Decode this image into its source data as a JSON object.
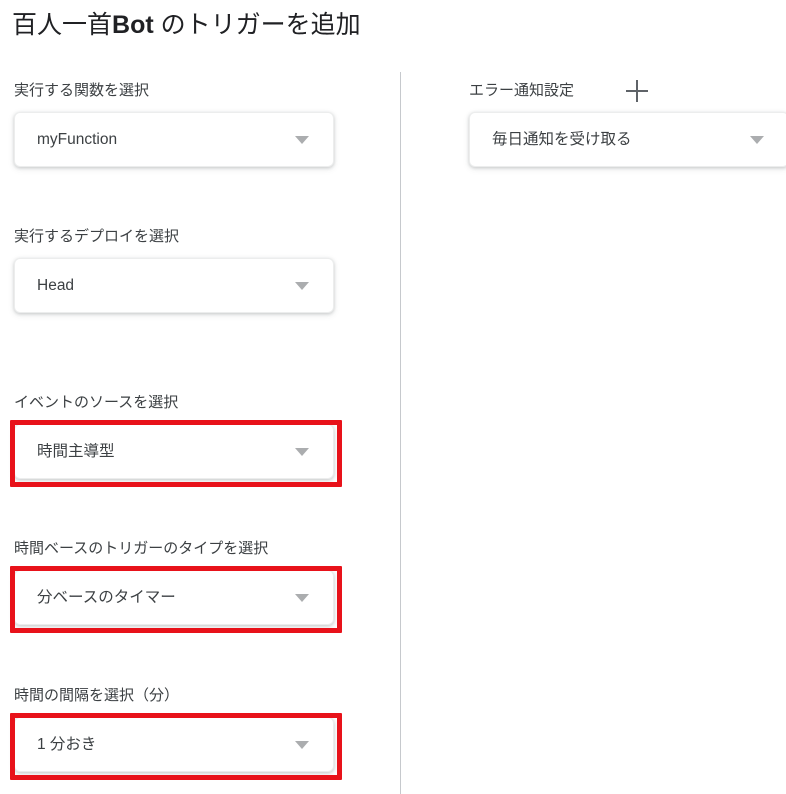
{
  "header": {
    "title_prefix": "百人一首",
    "title_strong": "Bot",
    "title_suffix": " のトリガーを追加"
  },
  "colors": {
    "highlight": "#e8121a",
    "background": "#ffffff",
    "text": "#3c4043",
    "chevron": "#abadaf",
    "divider": "#c6c9cd"
  },
  "left_column": {
    "fields": [
      {
        "label": "実行する関数を選択",
        "value": "myFunction",
        "highlighted": false,
        "icon": "chevron-down-icon"
      },
      {
        "label": "実行するデプロイを選択",
        "value": "Head",
        "highlighted": false,
        "icon": "chevron-down-icon"
      },
      {
        "label": "イベントのソースを選択",
        "value": "時間主導型",
        "highlighted": true,
        "icon": "chevron-down-icon"
      },
      {
        "label": "時間ベースのトリガーのタイプを選択",
        "value": "分ベースのタイマー",
        "highlighted": true,
        "icon": "chevron-down-icon"
      },
      {
        "label": "時間の間隔を選択（分）",
        "value": "1 分おき",
        "highlighted": true,
        "icon": "chevron-down-icon"
      }
    ]
  },
  "right_column": {
    "section_label": "エラー通知設定",
    "add_icon": "plus-icon",
    "fields": [
      {
        "value": "毎日通知を受け取る",
        "highlighted": false,
        "icon": "chevron-down-icon"
      }
    ]
  }
}
